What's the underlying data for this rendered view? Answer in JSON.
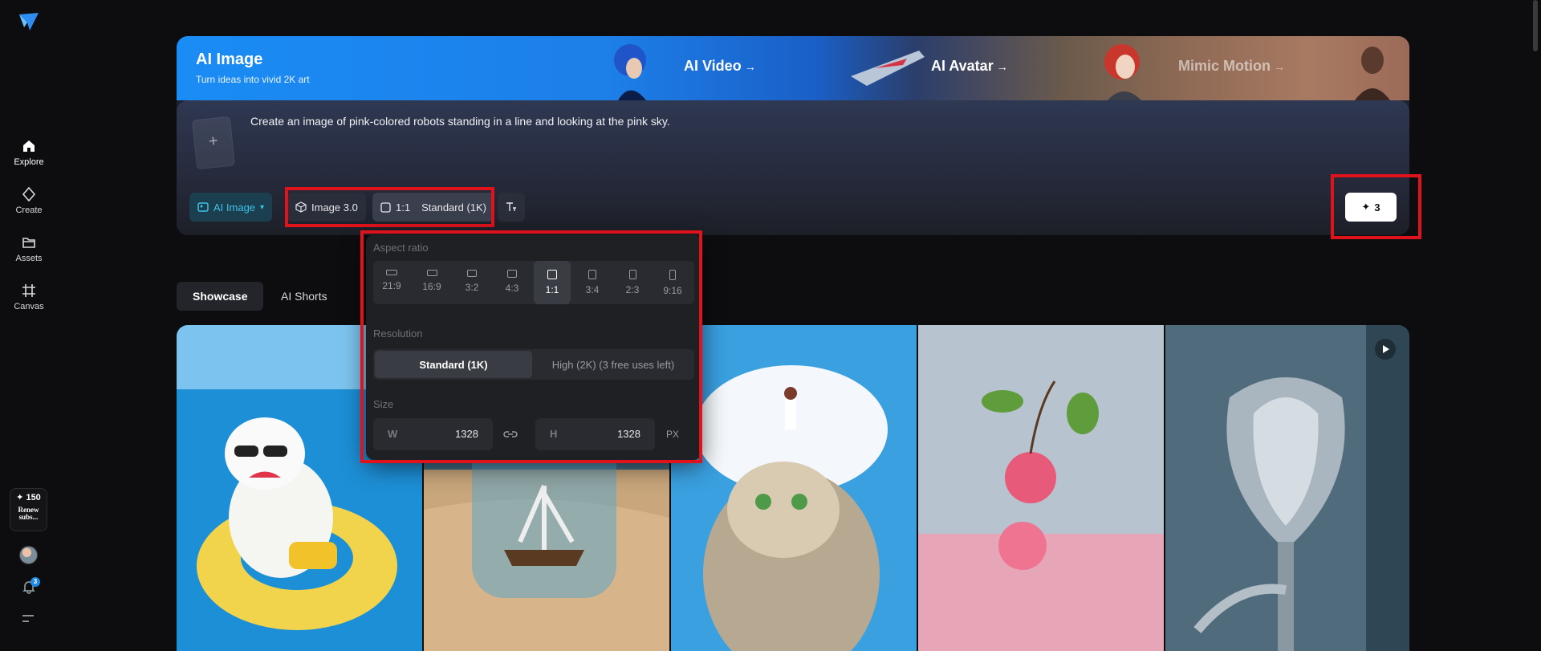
{
  "sidebar": {
    "items": [
      {
        "label": "Explore",
        "icon": "home-icon"
      },
      {
        "label": "Create",
        "icon": "sparkle-diamond-icon"
      },
      {
        "label": "Assets",
        "icon": "folder-icon"
      },
      {
        "label": "Canvas",
        "icon": "canvas-crop-icon"
      }
    ],
    "credits": "✦ 150",
    "renew": "Renew subs...",
    "notification_count": "3"
  },
  "hero": {
    "title": "AI Image",
    "subtitle": "Turn ideas into vivid 2K art",
    "tabs": [
      {
        "label": "AI Video",
        "arrow": "→"
      },
      {
        "label": "AI Avatar",
        "arrow": "→"
      },
      {
        "label": "Mimic Motion",
        "arrow": "→"
      }
    ],
    "prompt": "Create an image of pink-colored robots standing in a line and looking at the pink sky.",
    "upload_plus": "+"
  },
  "toolbar": {
    "mode_label": "AI Image",
    "model_label": "Image 3.0",
    "ratio_label": "1:1",
    "quality_label": "Standard (1K)",
    "generate_label": "3"
  },
  "popover": {
    "aspect_title": "Aspect ratio",
    "ratios": [
      "21:9",
      "16:9",
      "3:2",
      "4:3",
      "1:1",
      "3:4",
      "2:3",
      "9:16"
    ],
    "selected_ratio": "1:1",
    "resolution_title": "Resolution",
    "res_standard": "Standard (1K)",
    "res_high": "High (2K)  (3 free uses left)",
    "size_title": "Size",
    "w_label": "W",
    "w_value": "1328",
    "h_label": "H",
    "h_value": "1328",
    "unit": "PX"
  },
  "tabs": {
    "showcase": "Showcase",
    "shorts": "AI Shorts"
  },
  "colors": {
    "accent": "#3fc2e8",
    "highlight": "#e0121b",
    "hero_blue": "#1a8cf5"
  }
}
